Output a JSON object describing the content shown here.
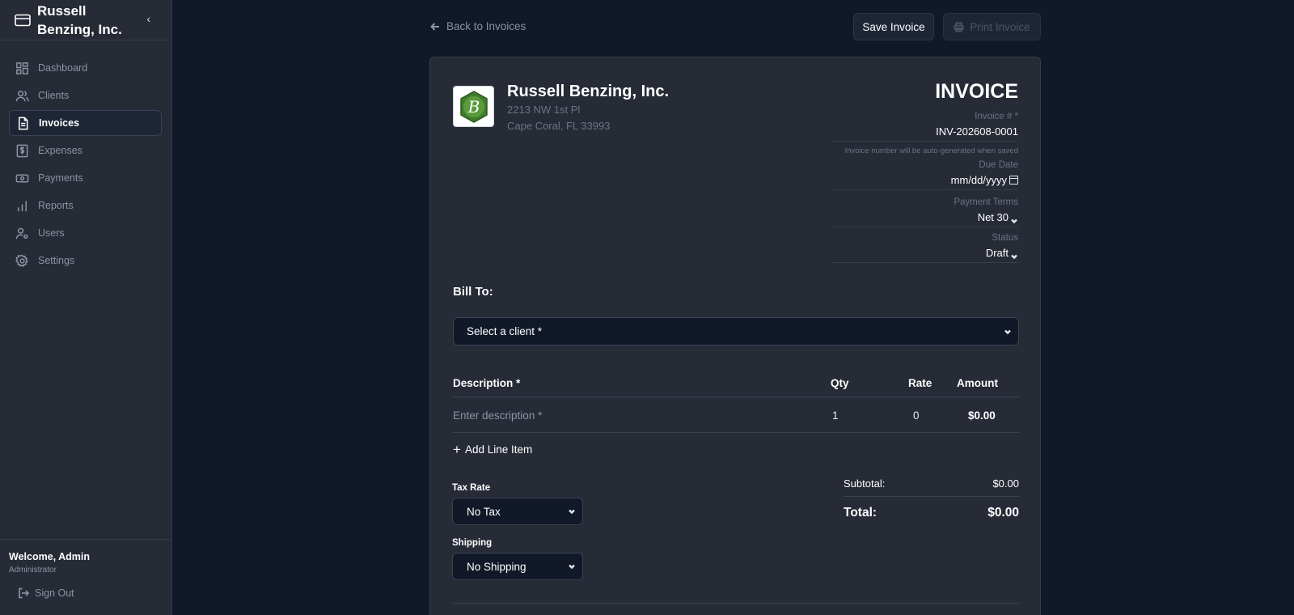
{
  "sidebar": {
    "brand_name": "Russell Benzing, Inc.",
    "items": [
      {
        "label": "Dashboard",
        "icon": "dashboard-icon"
      },
      {
        "label": "Clients",
        "icon": "users-icon"
      },
      {
        "label": "Invoices",
        "icon": "file-text-icon",
        "active": true
      },
      {
        "label": "Expenses",
        "icon": "dollar-receipt-icon"
      },
      {
        "label": "Payments",
        "icon": "banknote-icon"
      },
      {
        "label": "Reports",
        "icon": "bar-chart-icon"
      },
      {
        "label": "Users",
        "icon": "user-cog-icon"
      },
      {
        "label": "Settings",
        "icon": "gear-icon"
      }
    ],
    "welcome": "Welcome, Admin",
    "role": "Administrator",
    "sign_out": "Sign Out"
  },
  "toolbar": {
    "back_label": "Back to Invoices",
    "save_label": "Save Invoice",
    "print_label": "Print Invoice"
  },
  "invoice": {
    "company_name": "Russell Benzing, Inc.",
    "address_line1": "2213 NW 1st Pl",
    "address_line2": "Cape Coral, FL 33993",
    "title": "INVOICE",
    "number_label": "Invoice # *",
    "number_value": "INV-202608-0001",
    "number_hint": "Invoice number will be auto-generated when saved",
    "due_date_label": "Due Date",
    "due_date_placeholder": "mm/dd/yyyy",
    "terms_label": "Payment Terms",
    "terms_value": "Net 30",
    "status_label": "Status",
    "status_value": "Draft",
    "bill_to_label": "Bill To:",
    "client_placeholder": "Select a client *",
    "columns": {
      "description": "Description *",
      "qty": "Qty",
      "rate": "Rate",
      "amount": "Amount"
    },
    "line_items": [
      {
        "description_placeholder": "Enter description *",
        "qty": "1",
        "rate": "0",
        "amount": "$0.00"
      }
    ],
    "add_line_label": "Add Line Item",
    "tax_label": "Tax Rate",
    "tax_value": "No Tax",
    "shipping_label": "Shipping",
    "shipping_value": "No Shipping",
    "subtotal_label": "Subtotal:",
    "subtotal_value": "$0.00",
    "total_label": "Total:",
    "total_value": "$0.00"
  },
  "colors": {
    "background": "#111827",
    "panel": "#262b36",
    "muted_text": "#8b93a3",
    "logo_green": "#3f7d2c"
  }
}
